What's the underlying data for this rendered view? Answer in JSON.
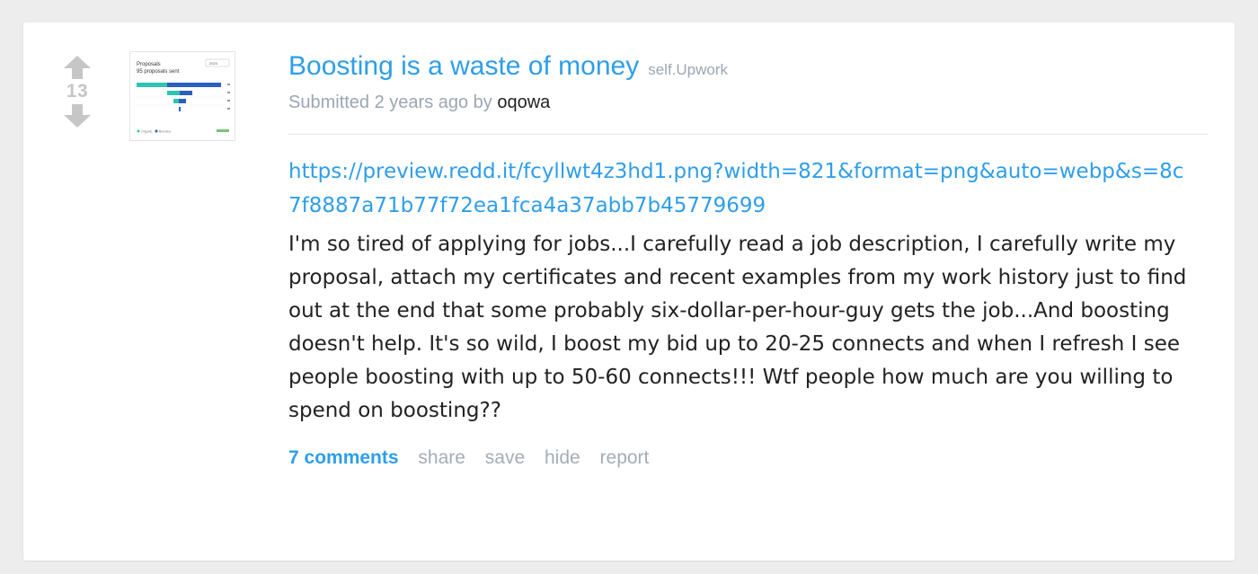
{
  "post": {
    "score": "13",
    "title": "Boosting is a waste of money",
    "domain": "self.Upwork",
    "submitted_prefix": "Submitted 2 years ago by",
    "author": "oqowa",
    "link": "https://preview.redd.it/fcyllwt4z3hd1.png?width=821&format=png&auto=webp&s=8c7f8887a71b77f72ea1fca4a37abb7b45779699",
    "body": "I'm so tired of applying for jobs...I carefully read a job description, I carefully write my proposal, attach my certificates and recent examples from my work history just to find out at the end that some probably six-dollar-per-hour-guy gets the job...And boosting doesn't help. It's so wild, I boost my bid up to 20-25 connects and when I refresh I see people boosting with up to 50-60 connects!!! Wtf people how much are you willing to spend on boosting??"
  },
  "thumbnail": {
    "label": "Proposals",
    "sublabel": "95 proposals sent",
    "dropdown": "2024",
    "legend_organic": "Organic",
    "legend_boosted": "Boosted"
  },
  "actions": {
    "comments": "7 comments",
    "share": "share",
    "save": "save",
    "hide": "hide",
    "report": "report"
  },
  "colors": {
    "link": "#2e9ee9",
    "muted": "#9aa7b3",
    "vote": "#c6c6c6"
  }
}
